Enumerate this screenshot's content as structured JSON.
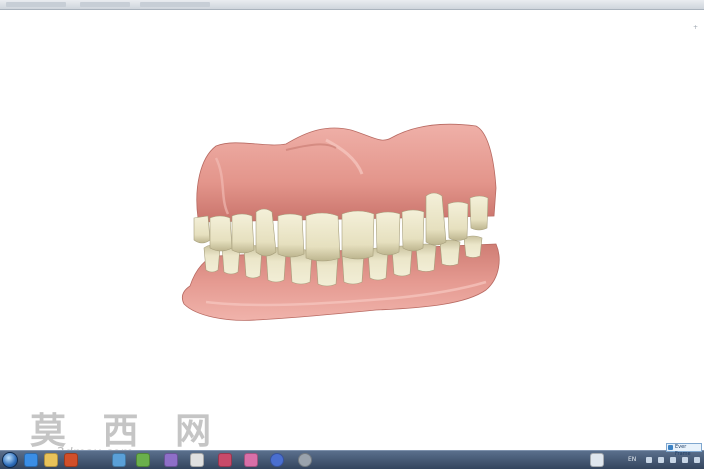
{
  "window": {
    "corner_mark": "+"
  },
  "watermark": {
    "text": "莫 西 网",
    "url": "3dmax.com"
  },
  "taskbar": {
    "tray_lang": "EN",
    "notification": "Ever Frame"
  },
  "colors": {
    "gum": "#e59a91",
    "gum_shadow": "#c9736b",
    "tooth": "#ece7cc",
    "tooth_shadow": "#bdb58f",
    "taskbar": "#3f5270"
  },
  "icons": [
    "start-orb-icon",
    "ie-icon",
    "folder-icon",
    "media-icon",
    "app-icon",
    "search-icon",
    "disc-icon"
  ]
}
